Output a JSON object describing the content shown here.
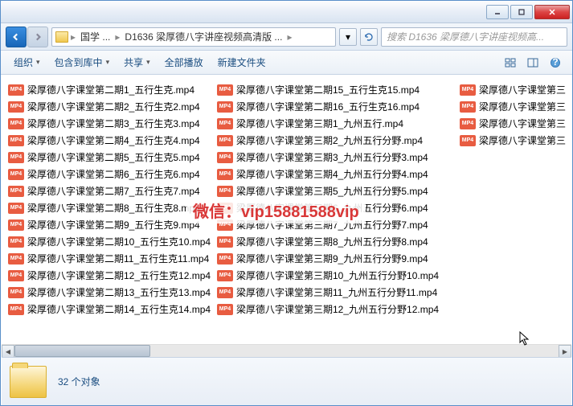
{
  "breadcrumb": {
    "p1": "国学 ...",
    "p2": "D1636 梁厚德八字讲座视频高清版 ..."
  },
  "search": {
    "placeholder": "搜索 D1636 梁厚德八字讲座视频高..."
  },
  "toolbar": {
    "organize": "组织",
    "include": "包含到库中",
    "share": "共享",
    "playall": "全部播放",
    "newfolder": "新建文件夹"
  },
  "watermark": "微信：vip15881588vip",
  "status": {
    "count": "32 个对象"
  },
  "mp4_label": "MP4",
  "files_col1": [
    "梁厚德八字课堂第二期1_五行生克.mp4",
    "梁厚德八字课堂第二期2_五行生克2.mp4",
    "梁厚德八字课堂第二期3_五行生克3.mp4",
    "梁厚德八字课堂第二期4_五行生克4.mp4",
    "梁厚德八字课堂第二期5_五行生克5.mp4",
    "梁厚德八字课堂第二期6_五行生克6.mp4",
    "梁厚德八字课堂第二期7_五行生克7.mp4",
    "梁厚德八字课堂第二期8_五行生克8.mp4",
    "梁厚德八字课堂第二期9_五行生克9.mp4",
    "梁厚德八字课堂第二期10_五行生克10.mp4",
    "梁厚德八字课堂第二期11_五行生克11.mp4",
    "梁厚德八字课堂第二期12_五行生克12.mp4",
    "梁厚德八字课堂第二期13_五行生克13.mp4",
    "梁厚德八字课堂第二期14_五行生克14.mp4"
  ],
  "files_col2": [
    "梁厚德八字课堂第二期15_五行生克15.mp4",
    "梁厚德八字课堂第二期16_五行生克16.mp4",
    "梁厚德八字课堂第三期1_九州五行.mp4",
    "梁厚德八字课堂第三期2_九州五行分野.mp4",
    "梁厚德八字课堂第三期3_九州五行分野3.mp4",
    "梁厚德八字课堂第三期4_九州五行分野4.mp4",
    "梁厚德八字课堂第三期5_九州五行分野5.mp4",
    "梁厚德八字课堂第三期6_九州五行分野6.mp4",
    "梁厚德八字课堂第三期7_九州五行分野7.mp4",
    "梁厚德八字课堂第三期8_九州五行分野8.mp4",
    "梁厚德八字课堂第三期9_九州五行分野9.mp4",
    "梁厚德八字课堂第三期10_九州五行分野10.mp4",
    "梁厚德八字课堂第三期11_九州五行分野11.mp4",
    "梁厚德八字课堂第三期12_九州五行分野12.mp4"
  ],
  "files_col3": [
    "梁厚德八字课堂第三",
    "梁厚德八字课堂第三",
    "梁厚德八字课堂第三",
    "梁厚德八字课堂第三"
  ]
}
